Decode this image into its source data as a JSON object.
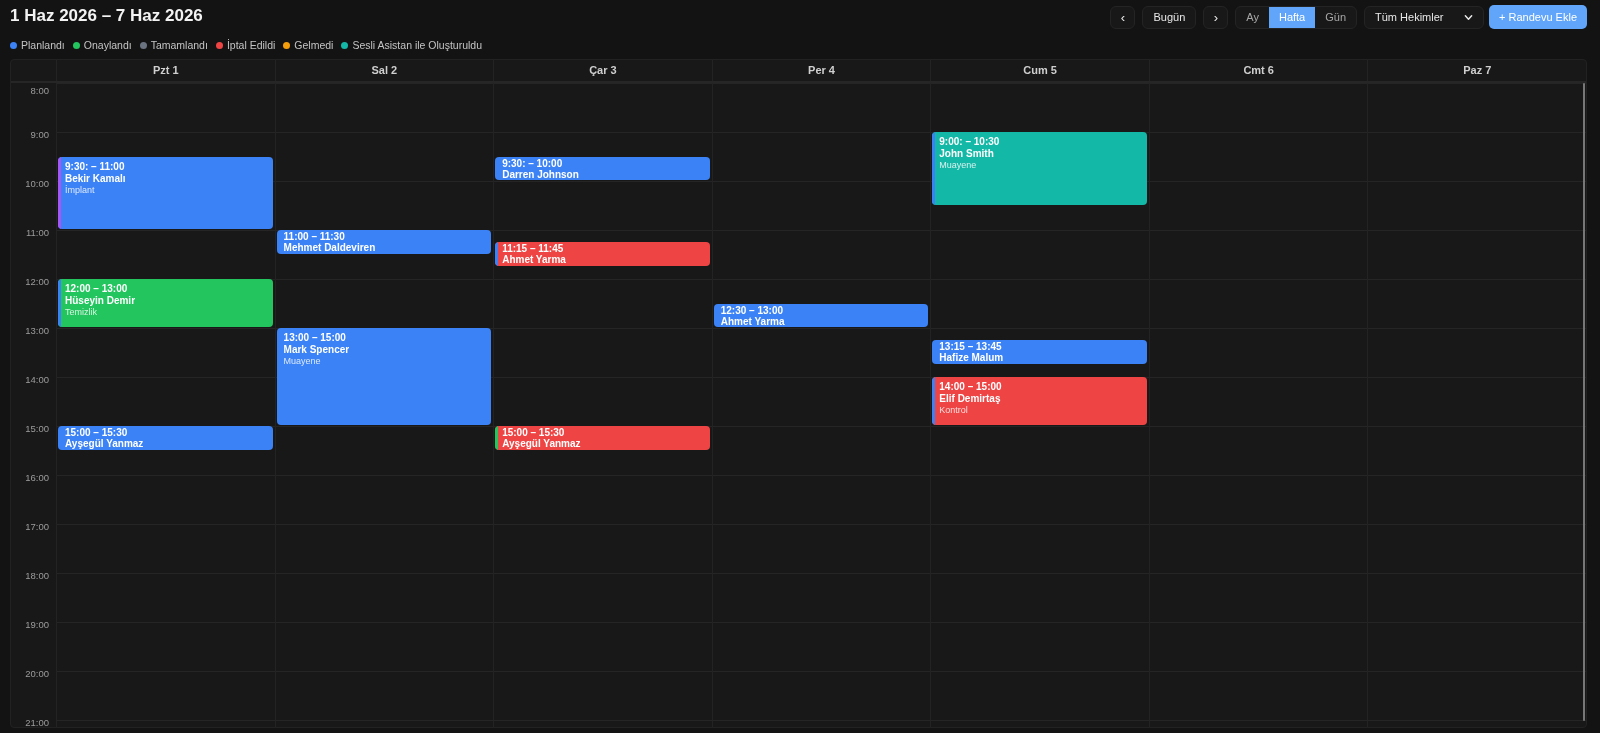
{
  "title": "1 Haz 2026 – 7 Haz 2026",
  "legend": [
    {
      "label": "Planlandı",
      "color": "#3b82f6"
    },
    {
      "label": "Onaylandı",
      "color": "#22c55e"
    },
    {
      "label": "Tamamlandı",
      "color": "#6b7280"
    },
    {
      "label": "İptal Edildi",
      "color": "#ef4444"
    },
    {
      "label": "Gelmedi",
      "color": "#f59e0b"
    },
    {
      "label": "Sesli Asistan ile Oluşturuldu",
      "color": "#14b8a6"
    }
  ],
  "toolbar": {
    "prev": "‹",
    "today": "Bugün",
    "next": "›",
    "views": [
      {
        "label": "Ay",
        "selected": false
      },
      {
        "label": "Hafta",
        "selected": true
      },
      {
        "label": "Gün",
        "selected": false
      }
    ],
    "doctor_filter": "Tüm Hekimler",
    "add_button": "+ Randevu Ekle"
  },
  "calendar": {
    "hours": [
      "8:00",
      "9:00",
      "10:00",
      "11:00",
      "12:00",
      "13:00",
      "14:00",
      "15:00",
      "16:00",
      "17:00",
      "18:00",
      "19:00",
      "20:00",
      "21:00"
    ],
    "days": [
      {
        "label": "Pzt 1",
        "events": [
          {
            "time": "9:30: – 11:00",
            "name": "Bekir Kamalı",
            "detail": "İmplant",
            "color": "#3b82f6",
            "stripe": {
              "color": "#a855f7"
            }
          },
          {
            "time": "12:00 – 13:00",
            "name": "Hüseyin Demir",
            "detail": "Temizlik",
            "color": "#22c55e",
            "stripe": {
              "color": "#3b82f6"
            }
          },
          {
            "time": "15:00 – 15:30",
            "name": "Ayşegül Yanmaz",
            "color": "#3b82f6"
          }
        ]
      },
      {
        "label": "Sal 2",
        "events": [
          {
            "time": "11:00 – 11:30",
            "name": "Mehmet Daldeviren",
            "color": "#3b82f6"
          },
          {
            "time": "13:00 – 15:00",
            "name": "Mark Spencer",
            "detail": "Muayene",
            "color": "#3b82f6"
          }
        ]
      },
      {
        "label": "Çar 3",
        "events": [
          {
            "time": "9:30: – 10:00",
            "name": "Darren Johnson",
            "color": "#3b82f6"
          },
          {
            "time": "11:15 – 11:45",
            "name": "Ahmet Yarma",
            "color": "#ef4444",
            "stripe": {
              "color": "#3b82f6"
            }
          },
          {
            "time": "15:00 – 15:30",
            "name": "Ayşegül Yanmaz",
            "color": "#ef4444",
            "stripe": {
              "color": "#22c55e"
            }
          }
        ]
      },
      {
        "label": "Per 4",
        "events": [
          {
            "time": "12:30 – 13:00",
            "name": "Ahmet Yarma",
            "color": "#3b82f6"
          }
        ]
      },
      {
        "label": "Cum 5",
        "events": [
          {
            "time": "9:00: – 10:30",
            "name": "John Smith",
            "detail": "Muayene",
            "color": "#14b8a6",
            "stripe": {
              "color": "#3b82f6"
            }
          },
          {
            "time": "13:15 – 13:45",
            "name": "Hafize Malum",
            "color": "#3b82f6"
          },
          {
            "time": "14:00 – 15:00",
            "name": "Elif Demirtaş",
            "detail": "Kontrol",
            "color": "#ef4444",
            "stripe": {
              "color": "#3b82f6"
            }
          }
        ]
      },
      {
        "label": "Cmt 6"
      },
      {
        "label": "Paz 7"
      }
    ]
  }
}
